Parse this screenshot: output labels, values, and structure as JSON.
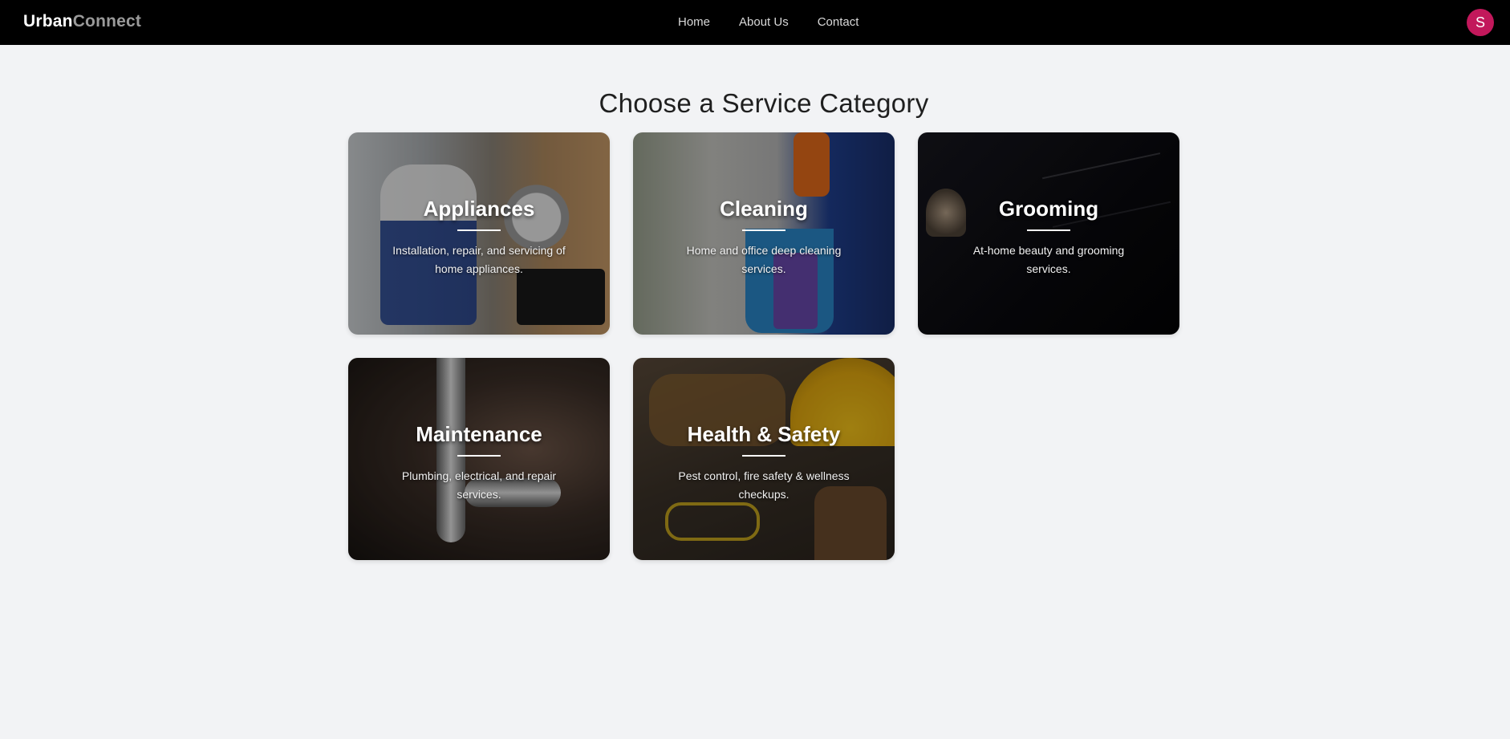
{
  "app": {
    "brand_part1": "Urban",
    "brand_part2": "Connect"
  },
  "nav": {
    "items": [
      {
        "label": "Home"
      },
      {
        "label": "About Us"
      },
      {
        "label": "Contact"
      }
    ],
    "avatar_initial": "S"
  },
  "main": {
    "title": "Choose a Service Category",
    "categories": [
      {
        "title": "Appliances",
        "description": "Installation, repair, and servicing of home appliances."
      },
      {
        "title": "Cleaning",
        "description": "Home and office deep cleaning services."
      },
      {
        "title": "Grooming",
        "description": "At-home beauty and grooming services."
      },
      {
        "title": "Maintenance",
        "description": "Plumbing, electrical, and repair services."
      },
      {
        "title": "Health & Safety",
        "description": "Pest control, fire safety & wellness checkups."
      }
    ]
  },
  "colors": {
    "navbar_bg": "#000000",
    "page_bg": "#f2f3f5",
    "avatar_bg": "#c2185b"
  }
}
